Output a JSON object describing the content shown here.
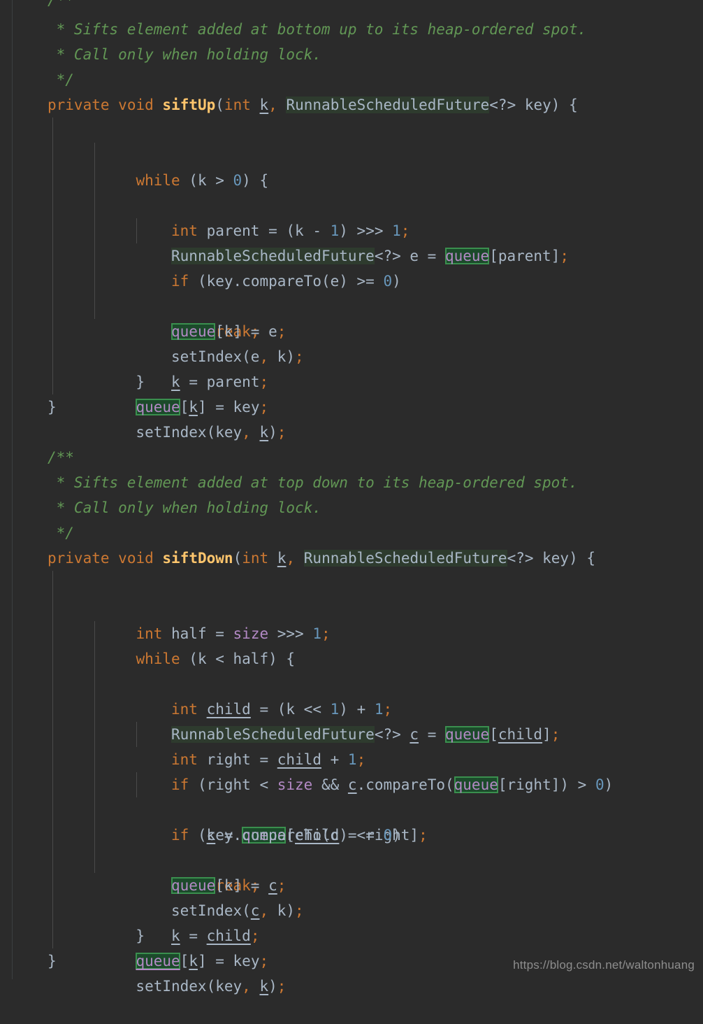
{
  "editor": {
    "background": "#2b2b2b",
    "default_text_color": "#a9b7c6",
    "comment_color": "#629755",
    "keyword_color": "#cc7832",
    "method_name_color": "#ffc66d",
    "number_color": "#6897bb",
    "field_color": "#b389c5",
    "usage_highlight_color": "#2e3b2e",
    "write_usage_highlight_fill": "#1c4a2b",
    "write_usage_highlight_border": "#3a8f4e",
    "gutter_rule_color": "#3c3f41",
    "indent_guide_color": "#4a4a4a",
    "language": "Java",
    "font_size_px": 21,
    "line_height_px": 36
  },
  "watermark": {
    "text": "https://blog.csdn.net/waltonhuang"
  },
  "code": {
    "lines": [
      "/**",
      " * Sifts element added at bottom up to its heap-ordered spot.",
      " * Call only when holding lock.",
      " */",
      "private void siftUp(int k, RunnableScheduledFuture<?> key) {",
      "    while (k > 0) {",
      "        int parent = (k - 1) >>> 1;",
      "        RunnableScheduledFuture<?> e = queue[parent];",
      "        if (key.compareTo(e) >= 0)",
      "            break;",
      "        queue[k] = e;",
      "        setIndex(e, k);",
      "        k = parent;",
      "    }",
      "    queue[k] = key;",
      "    setIndex(key, k);",
      "}",
      "",
      "/**",
      " * Sifts element added at top down to its heap-ordered spot.",
      " * Call only when holding lock.",
      " */",
      "private void siftDown(int k, RunnableScheduledFuture<?> key) {",
      "    int half = size >>> 1;",
      "    while (k < half) {",
      "        int child = (k << 1) + 1;",
      "        RunnableScheduledFuture<?> c = queue[child];",
      "        int right = child + 1;",
      "        if (right < size && c.compareTo(queue[right]) > 0)",
      "            c = queue[child = right];",
      "        if (key.compareTo(c) <= 0)",
      "            break;",
      "        queue[k] = c;",
      "        setIndex(c, k);",
      "        k = child;",
      "    }",
      "    queue[k] = key;",
      "    setIndex(key, k);",
      "}"
    ],
    "highlighted_identifiers": {
      "soft": "RunnableScheduledFuture",
      "boxed": "queue"
    }
  }
}
